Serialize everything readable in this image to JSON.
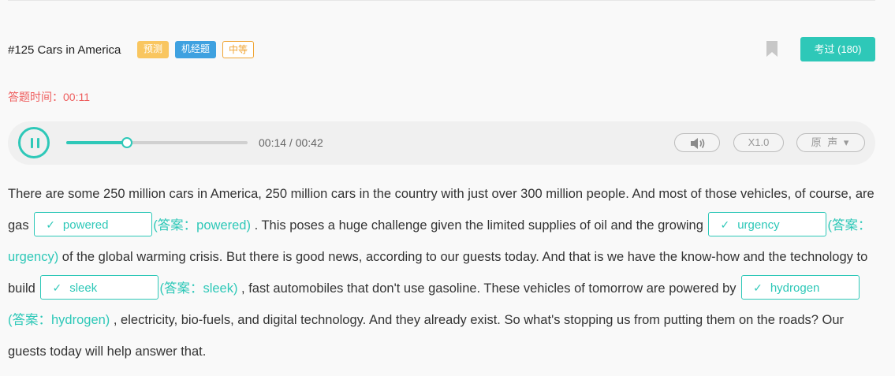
{
  "header": {
    "title": "#125 Cars in America",
    "tags": [
      "预测",
      "机经题",
      "中等"
    ],
    "pass_button": "考过 (180)"
  },
  "timer": {
    "label": "答题时间：",
    "value": "00:11"
  },
  "player": {
    "current": "00:14",
    "total": "00:42",
    "time_text": "00:14 / 00:42",
    "progress_fraction": 0.333,
    "speed": "X1.0",
    "voice": "原 声 ▾",
    "volume_icon": "volume-icon"
  },
  "passage": {
    "seg1": "There are some 250 million cars in America, 250 million cars in the country with just over 300 million people. And most of those vehicles, of course, are gas ",
    "seg2": " . This poses a huge challenge given the limited supplies of oil and the growing ",
    "seg3": " of the global warming crisis. But there is good news, according to our guests today. And that is we have the know-how and the technology to build ",
    "seg4": " , fast automobiles that don't use gasoline. These vehicles of tomorrow are powered by ",
    "seg5": " , electricity, bio-fuels, and digital technology. And they already exist. So what's stopping us from putting them on the roads? Our guests today will help answer that.",
    "check_mark": "✓",
    "blanks": [
      {
        "value": "powered",
        "answer": "(答案：powered)"
      },
      {
        "value": "urgency",
        "answer": "(答案：urgency)"
      },
      {
        "value": "sleek",
        "answer": "(答案：sleek)"
      },
      {
        "value": "hydrogen",
        "answer": "(答案：hydrogen)"
      }
    ]
  },
  "colors": {
    "accent": "#2ec8b8",
    "timer": "#ee5d5d",
    "tag_yellow": "#f9c660",
    "tag_blue": "#3ea1e0",
    "tag_orange": "#f0a431"
  }
}
